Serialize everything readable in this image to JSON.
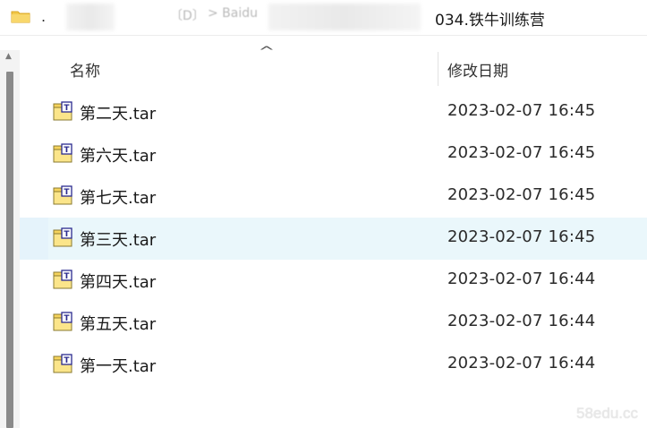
{
  "address_bar": {
    "dot": ".",
    "faint_segment_1": "〔D〕",
    "faint_segment_2": "> Baidu",
    "current_folder": "034.铁牛训练营"
  },
  "columns": {
    "name_label": "名称",
    "date_label": "修改日期"
  },
  "files": [
    {
      "name": "第二天.tar",
      "date": "2023-02-07 16:45",
      "icon": "tar-archive-icon"
    },
    {
      "name": "第六天.tar",
      "date": "2023-02-07 16:45",
      "icon": "tar-archive-icon"
    },
    {
      "name": "第七天.tar",
      "date": "2023-02-07 16:45",
      "icon": "tar-archive-icon"
    },
    {
      "name": "第三天.tar",
      "date": "2023-02-07 16:45",
      "icon": "tar-archive-icon",
      "hovered": true
    },
    {
      "name": "第四天.tar",
      "date": "2023-02-07 16:44",
      "icon": "tar-archive-icon"
    },
    {
      "name": "第五天.tar",
      "date": "2023-02-07 16:44",
      "icon": "tar-archive-icon"
    },
    {
      "name": "第一天.tar",
      "date": "2023-02-07 16:44",
      "icon": "tar-archive-icon"
    }
  ],
  "watermark": "58edu.cc",
  "colors": {
    "hover_row": "#e5f3fb",
    "folder_yellow": "#f5c242",
    "icon_badge": "#2b2b8f"
  }
}
